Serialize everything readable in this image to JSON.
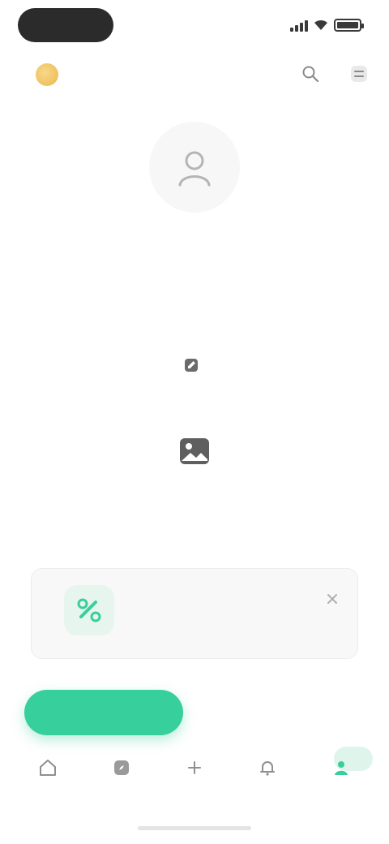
{
  "status_bar": {
    "time": "",
    "battery_level_percent": 100
  },
  "header": {
    "brand_label": "",
    "actions": [
      "search-icon",
      "menu-icon"
    ]
  },
  "profile": {
    "avatar_icon": "user-icon",
    "name": "",
    "handle": "",
    "stats": [
      {
        "value": "",
        "label": ""
      },
      {
        "value": "",
        "label": ""
      },
      {
        "value": "",
        "label": ""
      }
    ],
    "edit_label": ""
  },
  "empty_state": {
    "icon": "photo-icon",
    "title": "",
    "subtitle": ""
  },
  "promo": {
    "icon": "link-icon",
    "title": "",
    "description": "",
    "close_icon": "close-icon"
  },
  "actions": {
    "primary_label": "",
    "secondary_label": ""
  },
  "bottom_nav": {
    "items": [
      {
        "icon": "home-icon",
        "label": ""
      },
      {
        "icon": "compass-icon",
        "label": ""
      },
      {
        "icon": "plus-icon",
        "label": ""
      },
      {
        "icon": "bell-icon",
        "label": ""
      },
      {
        "icon": "profile-icon",
        "label": ""
      }
    ],
    "active_index": 4
  },
  "colors": {
    "accent": "#37cf9b",
    "brand_icon": "#f1c667",
    "status_pill": "#2b2b2b"
  }
}
